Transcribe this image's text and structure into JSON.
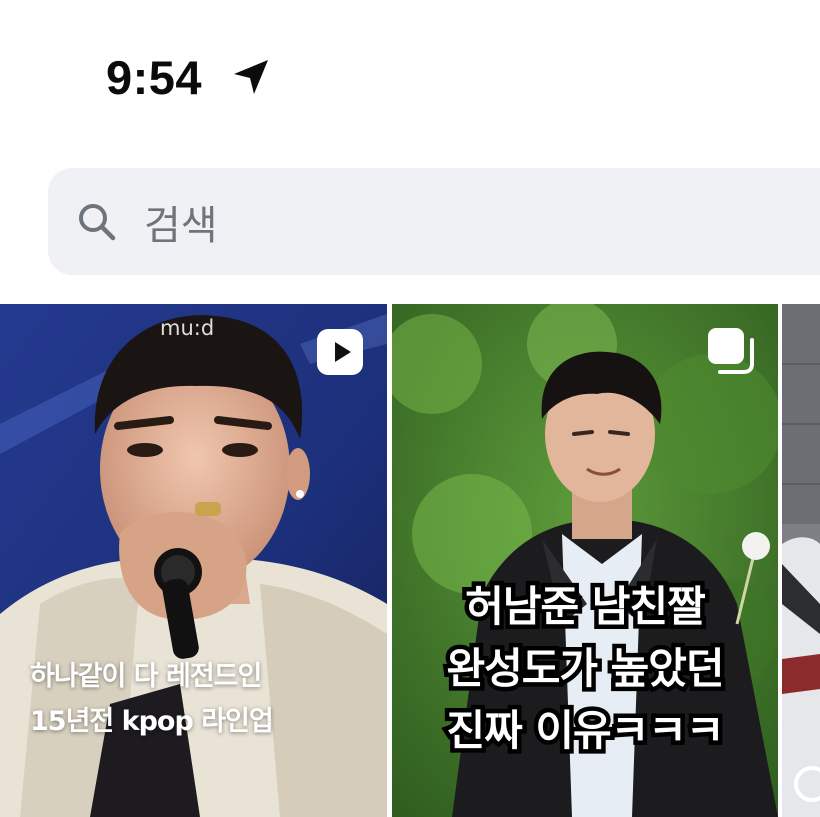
{
  "status_bar": {
    "time": "9:54",
    "location_icon": "location-arrow-icon"
  },
  "search": {
    "icon": "search-icon",
    "placeholder": "검색"
  },
  "grid": {
    "tiles": [
      {
        "type": "video",
        "badge_icon": "play-icon",
        "watermark": "mu:d",
        "caption_lines": [
          "하나같이 다 레전드인",
          "15년전 kpop 라인업"
        ]
      },
      {
        "type": "carousel",
        "badge_icon": "multiple-posts-icon",
        "caption_lines": [
          "허남준 남친짤",
          "완성도가 높았던",
          "진짜 이유ㅋㅋㅋ"
        ]
      },
      {
        "type": "partial",
        "description_icon": "car-thumbnail"
      }
    ]
  },
  "colors": {
    "search_bg": "#eff1f5",
    "placeholder": "#6e747c",
    "text": "#0b0b0b"
  }
}
